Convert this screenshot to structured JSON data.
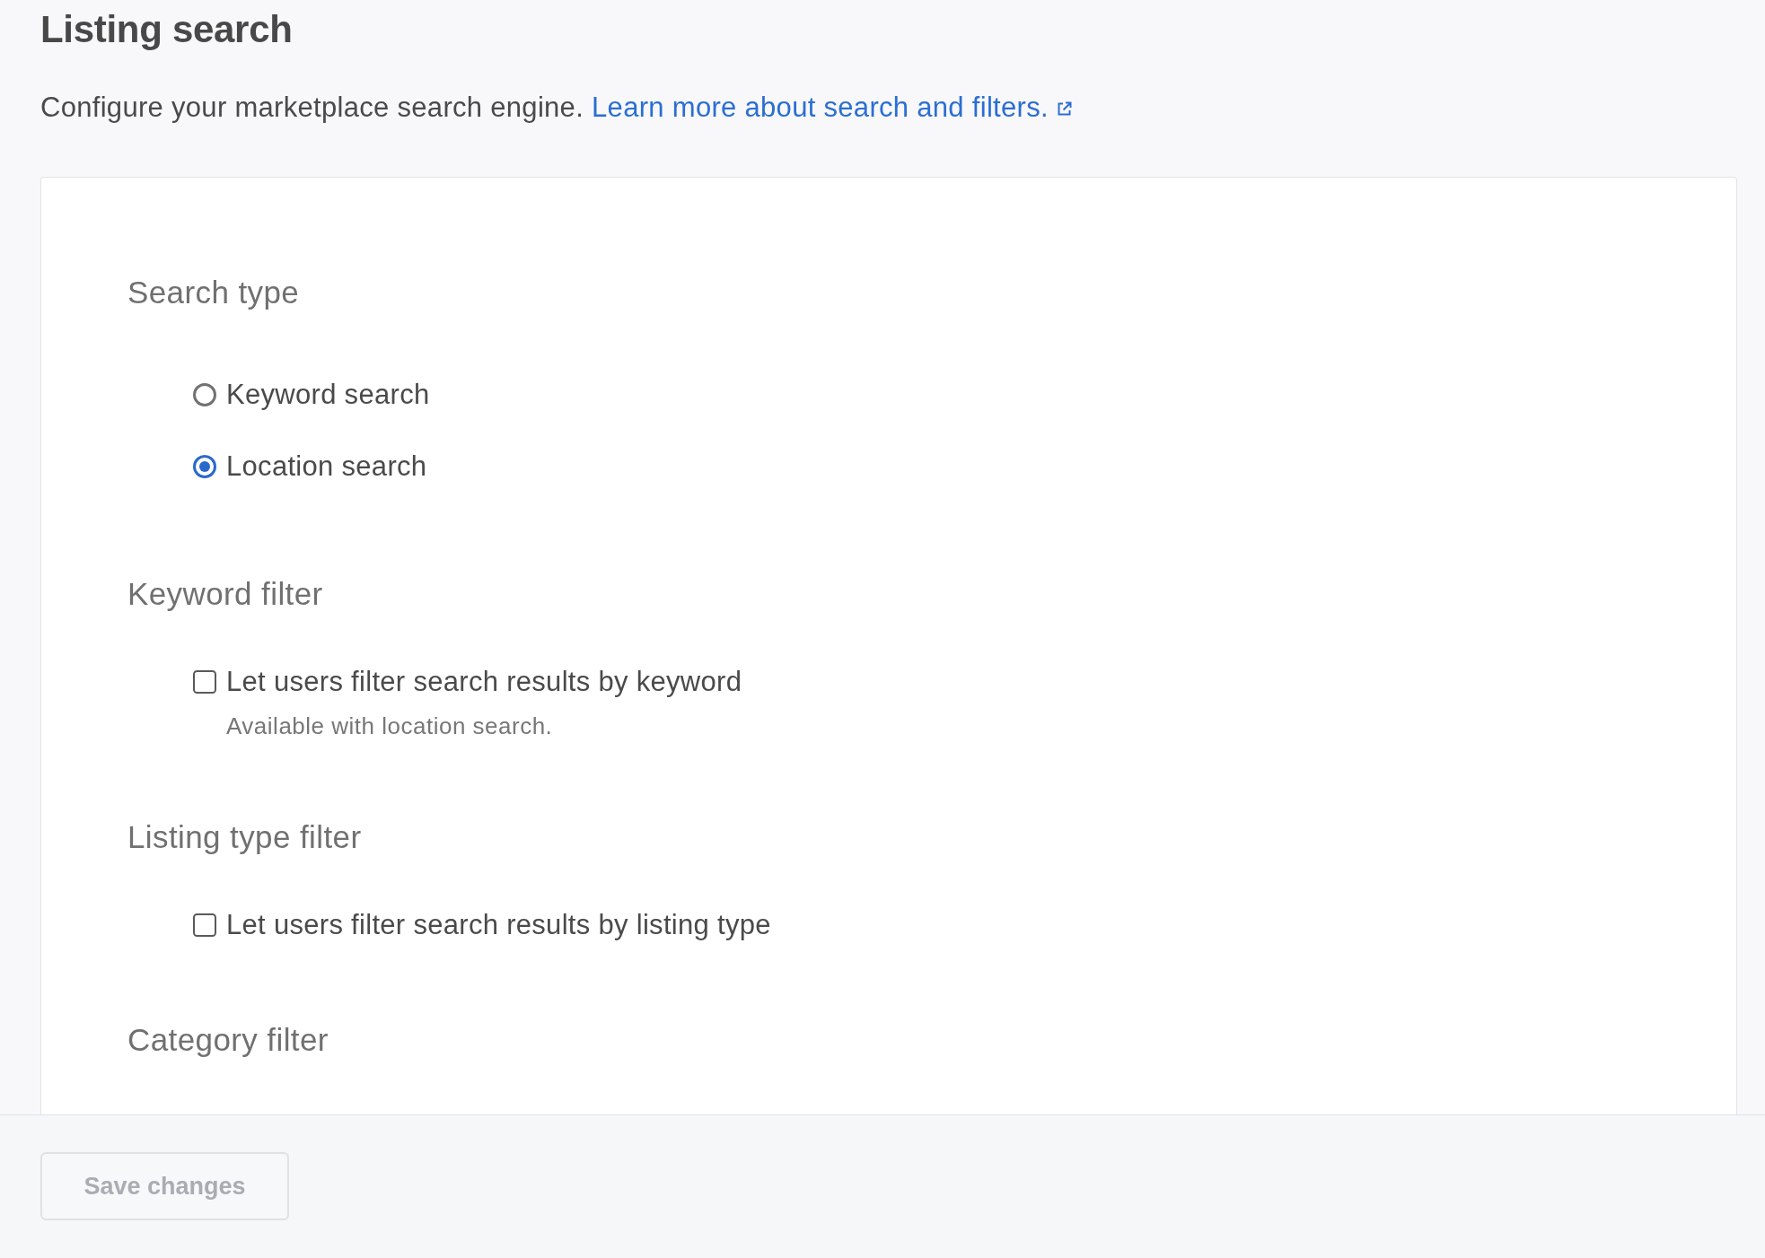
{
  "page": {
    "title": "Listing search",
    "description": "Configure your marketplace search engine.",
    "link": "Learn more about search and filters."
  },
  "sections": [
    {
      "heading": "Search type",
      "options": [
        {
          "kind": "radio",
          "label": "Keyword search",
          "selected": false
        },
        {
          "kind": "radio",
          "label": "Location search",
          "selected": true
        }
      ]
    },
    {
      "heading": "Keyword filter",
      "options": [
        {
          "kind": "checkbox",
          "label": "Let users filter search results by keyword",
          "checked": false,
          "hint": "Available with location search."
        }
      ]
    },
    {
      "heading": "Listing type filter",
      "options": [
        {
          "kind": "checkbox",
          "label": "Let users filter search results by listing type",
          "checked": false
        }
      ]
    },
    {
      "heading": "Category filter"
    }
  ],
  "footer": {
    "save_button": {
      "label": "Save changes",
      "disabled": true
    }
  }
}
